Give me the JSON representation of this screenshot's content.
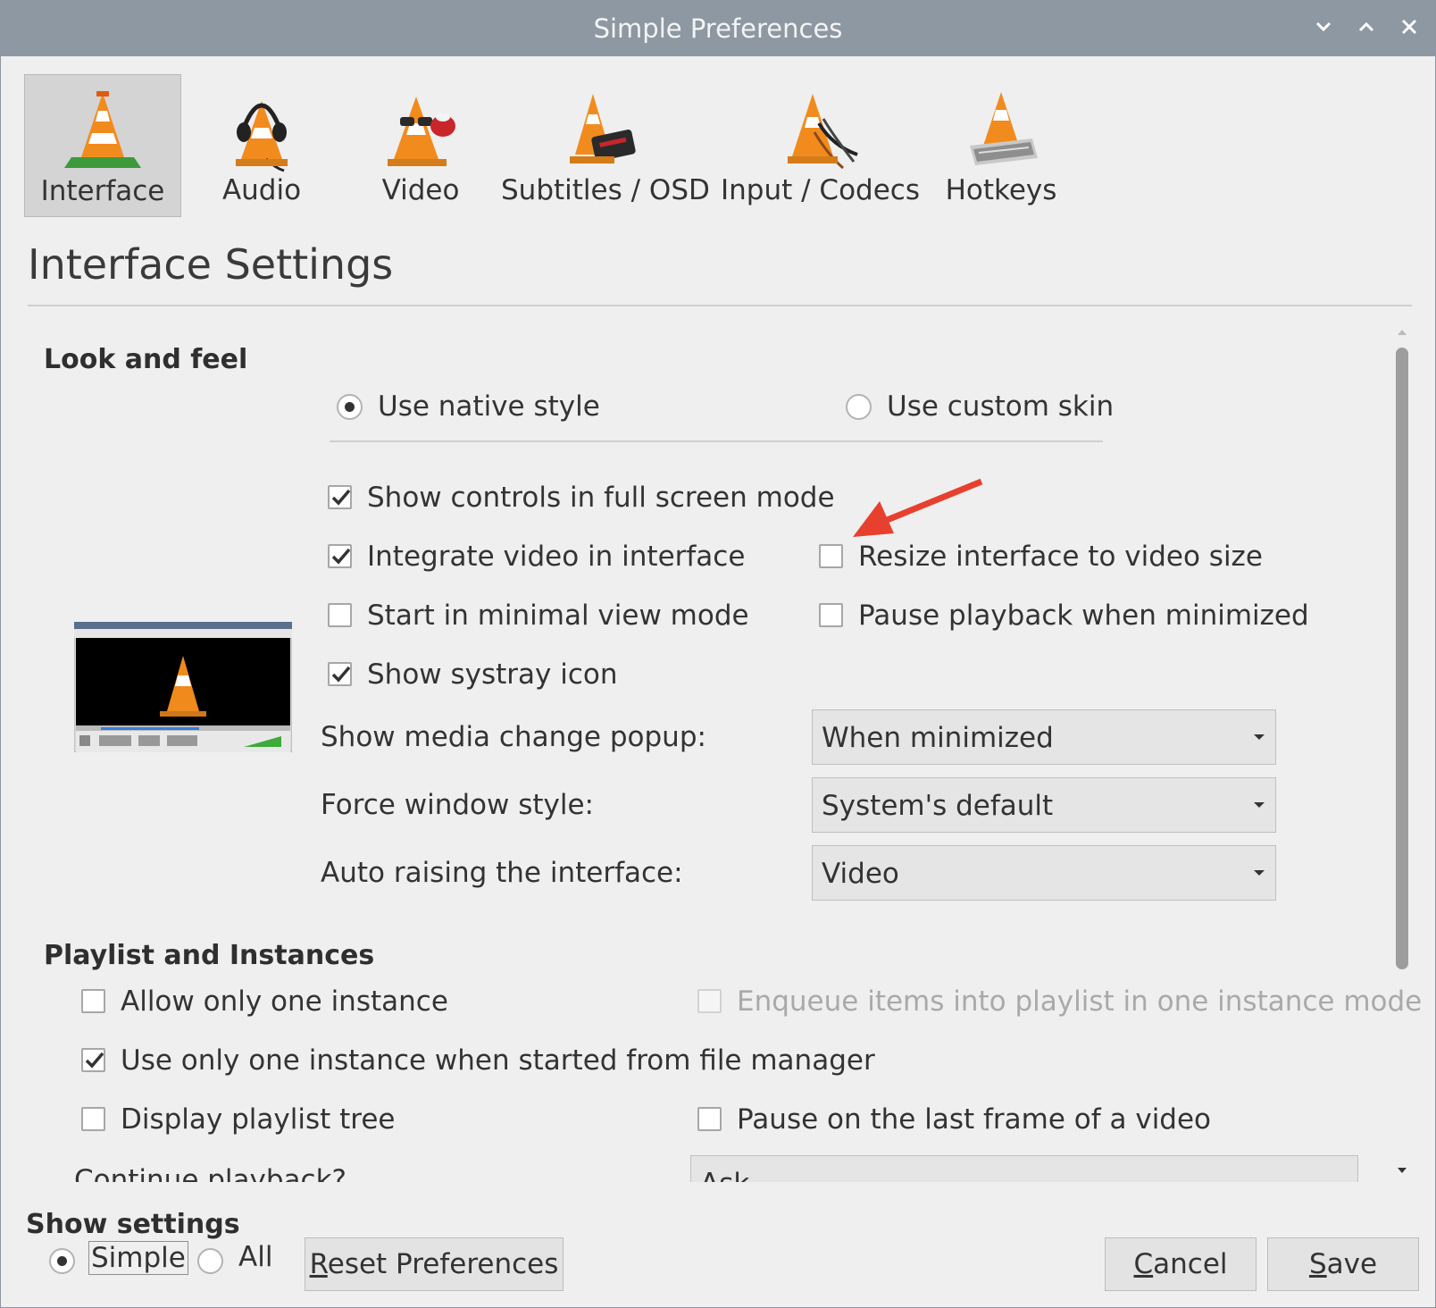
{
  "window": {
    "title": "Simple Preferences",
    "controls": [
      "minimize",
      "maximize",
      "close"
    ]
  },
  "categories": [
    {
      "label": "Interface",
      "icon": "vlc-cone-interface-icon",
      "selected": true
    },
    {
      "label": "Audio",
      "icon": "vlc-cone-headphones-icon",
      "selected": false
    },
    {
      "label": "Video",
      "icon": "vlc-cone-glasses-icon",
      "selected": false
    },
    {
      "label": "Subtitles / OSD",
      "icon": "vlc-cone-subtitles-icon",
      "selected": false
    },
    {
      "label": "Input / Codecs",
      "icon": "vlc-cone-cables-icon",
      "selected": false
    },
    {
      "label": "Hotkeys",
      "icon": "vlc-cone-keyboard-icon",
      "selected": false
    }
  ],
  "page_heading": "Interface Settings",
  "look_and_feel": {
    "title": "Look and feel",
    "native_style": {
      "label": "Use native style",
      "selected": true
    },
    "custom_skin": {
      "label": "Use custom skin",
      "selected": false
    },
    "show_controls_fullscreen": {
      "label": "Show controls in full screen mode",
      "checked": true
    },
    "integrate_video": {
      "label": "Integrate video in interface",
      "checked": true
    },
    "resize_interface": {
      "label": "Resize interface to video size",
      "checked": false
    },
    "minimal_view": {
      "label": "Start in minimal view mode",
      "checked": false
    },
    "pause_minimized": {
      "label": "Pause playback when minimized",
      "checked": false
    },
    "systray_icon": {
      "label": "Show systray icon",
      "checked": true
    },
    "media_change_popup": {
      "label": "Show media change popup:",
      "value": "When minimized"
    },
    "force_window_style": {
      "label": "Force window style:",
      "value": "System's default"
    },
    "auto_raising": {
      "label": "Auto raising the interface:",
      "value": "Video"
    }
  },
  "playlist": {
    "title": "Playlist and Instances",
    "one_instance": {
      "label": "Allow only one instance",
      "checked": false
    },
    "enqueue_items": {
      "label": "Enqueue items into playlist in one instance mode",
      "checked": false,
      "disabled": true
    },
    "one_instance_file_manager": {
      "label": "Use only one instance when started from file manager",
      "checked": true
    },
    "playlist_tree": {
      "label": "Display playlist tree",
      "checked": false
    },
    "pause_last_frame": {
      "label": "Pause on the last frame of a video",
      "checked": false
    },
    "continue_playback": {
      "label": "Continue playback?",
      "value": "Ask"
    }
  },
  "footer": {
    "show_settings": "Show settings",
    "simple": {
      "label": "Simple",
      "selected": true
    },
    "all": {
      "label": "All",
      "selected": false
    },
    "reset": {
      "label_u": "R",
      "label_rest": "eset Preferences"
    },
    "cancel": {
      "label_u": "C",
      "label_rest": "ancel"
    },
    "save": {
      "label_u": "S",
      "label_rest": "ave"
    }
  },
  "colors": {
    "titlebar": "#8d98a2",
    "annotation_arrow": "#e8402e",
    "preview_cone": "#f08a1c"
  }
}
